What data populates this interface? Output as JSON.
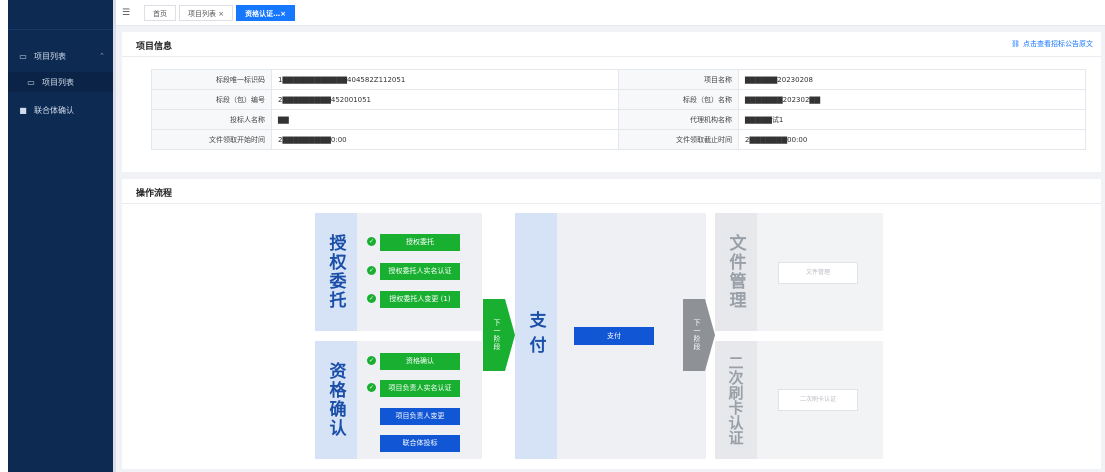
{
  "sidebar": {
    "items": [
      {
        "label": "项目列表",
        "icon": "folder-icon"
      },
      {
        "label": "项目列表",
        "icon": "folder-icon"
      },
      {
        "label": "联合体确认",
        "icon": "chat-icon"
      }
    ]
  },
  "topbar": {
    "tabs": [
      {
        "label": "首页",
        "active": false
      },
      {
        "label": "项目列表 ×",
        "active": false
      },
      {
        "label": "资格认证…×",
        "active": true
      }
    ]
  },
  "project_info": {
    "title": "项目信息",
    "link": "点击查看招标公告原文",
    "rows": [
      {
        "l1": "标段唯一标识码",
        "v1": "1▇▇▇▇▇▇▇▇▇▇▇▇404582Z112051",
        "l2": "项目名称",
        "v2": "▇▇▇▇▇▇20230208"
      },
      {
        "l1": "标段（包）编号",
        "v1": "2▇▇▇▇▇▇▇▇▇452001051",
        "l2": "标段（包）名称",
        "v2": "▇▇▇▇▇▇▇202302▇▇"
      },
      {
        "l1": "投标人名称",
        "v1": "▇▇",
        "l2": "代理机构名称",
        "v2": "▇▇▇▇▇试1"
      },
      {
        "l1": "文件领取开始时间",
        "v1": "2▇▇▇▇▇▇▇▇▇0:00",
        "l2": "文件领取截止时间",
        "v2": "2▇▇▇▇▇▇▇00:00"
      }
    ]
  },
  "process": {
    "title": "操作流程",
    "stage1": {
      "title": "授权委托",
      "items": [
        "授权委托",
        "授权委托人实名认证",
        "授权委托人变更 (1)"
      ]
    },
    "stage2": {
      "title": "资格确认",
      "items": [
        "资格确认",
        "项目负责人实名认证",
        "项目负责人变更",
        "联合体投标"
      ]
    },
    "next1": "下一阶段",
    "pay": {
      "title": "支付",
      "button": "支付"
    },
    "next2": "下一阶段",
    "stage3": {
      "title": "文件管理",
      "button": "文件管理"
    },
    "stage4": {
      "title": "二次刷卡认证",
      "button": "二次刷卡认证"
    }
  },
  "colors": {
    "navy": "#0c2a52",
    "accent": "#1677ff",
    "green": "#19b031",
    "blue": "#1156d4"
  }
}
